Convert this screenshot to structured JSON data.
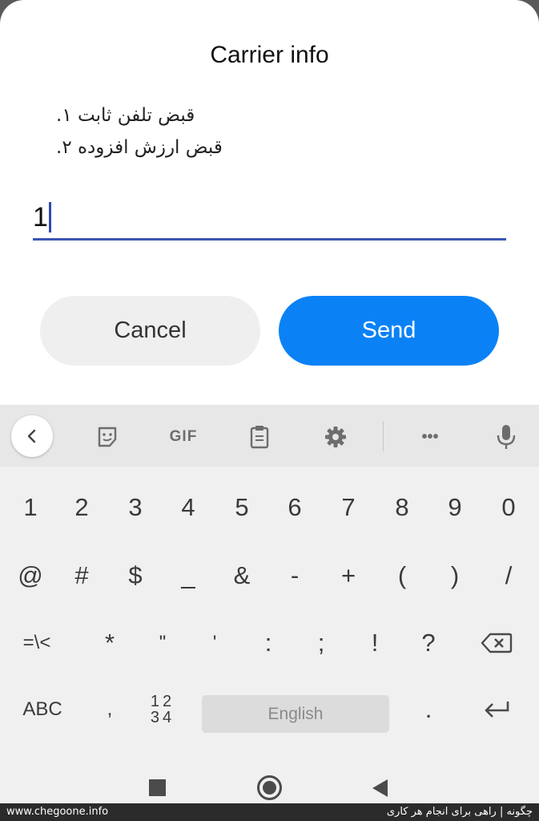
{
  "dialog": {
    "title": "Carrier info",
    "menu_lines": [
      "قبض تلفن ثابت ۱.",
      "قبض ارزش افزوده ۲."
    ],
    "input_value": "1",
    "cancel_label": "Cancel",
    "send_label": "Send"
  },
  "keyboard": {
    "toolbar": {
      "icons": [
        "back-icon",
        "sticker-icon",
        "gif-icon",
        "clipboard-icon",
        "gear-icon",
        "more-icon",
        "mic-icon"
      ],
      "gif_label": "GIF",
      "more_label": "•••"
    },
    "row1": [
      "1",
      "2",
      "3",
      "4",
      "5",
      "6",
      "7",
      "8",
      "9",
      "0"
    ],
    "row2": [
      "@",
      "#",
      "$",
      "_",
      "&",
      "-",
      "+",
      "(",
      ")",
      "/"
    ],
    "row3": [
      "=\\<",
      "*",
      "\"",
      "'",
      ":",
      ";",
      "!",
      "?"
    ],
    "abc_label": "ABC",
    "comma_label": ",",
    "numpad_top": "12",
    "numpad_bottom": "34",
    "space_label": "English",
    "period_label": "."
  },
  "watermark": {
    "left": "www.chegoone.info",
    "right": "چگونه | راهی برای انجام هر کاری"
  },
  "colors": {
    "accent": "#0a82f6",
    "input_underline": "#3b55b3"
  }
}
